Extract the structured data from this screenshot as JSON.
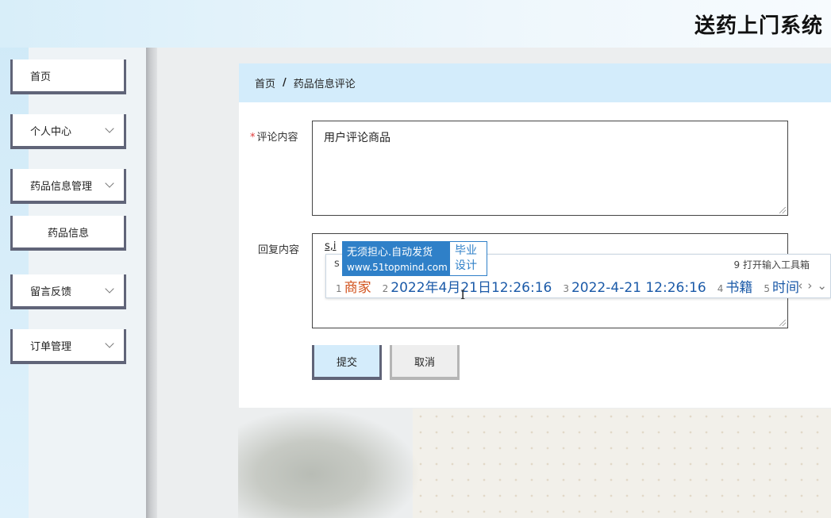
{
  "app": {
    "title": "送药上门系统"
  },
  "sidebar": {
    "items": [
      {
        "label": "首页",
        "has_children": false
      },
      {
        "label": "个人中心",
        "has_children": true
      },
      {
        "label": "药品信息管理",
        "has_children": true
      },
      {
        "label": "药品信息",
        "is_sub": true
      },
      {
        "label": "留言反馈",
        "has_children": true
      },
      {
        "label": "订单管理",
        "has_children": true
      }
    ]
  },
  "breadcrumb": {
    "home": "首页",
    "separator": "/",
    "current": "药品信息评论"
  },
  "form": {
    "comment": {
      "label": "评论内容",
      "required": "*",
      "value": "用户评论商品"
    },
    "reply": {
      "label": "回复内容",
      "typed": "s,i"
    },
    "submit_label": "提交",
    "cancel_label": "取消"
  },
  "ime": {
    "composition": "s",
    "tool_label": "9 打开输入工具箱",
    "candidates": [
      {
        "num": "1",
        "text": "商家"
      },
      {
        "num": "2",
        "text": "2022年4月21日12:26:16"
      },
      {
        "num": "3",
        "text": "2022-4-21 12:26:16"
      },
      {
        "num": "4",
        "text": "书籍"
      },
      {
        "num": "5",
        "text": "时间"
      }
    ],
    "nav_prev": "‹",
    "nav_next": "›",
    "nav_more": "⌄"
  },
  "ad": {
    "line1": "无须担心.自动发货",
    "url": "www.51topmind.com",
    "right1": "毕业",
    "right2": "设计"
  }
}
